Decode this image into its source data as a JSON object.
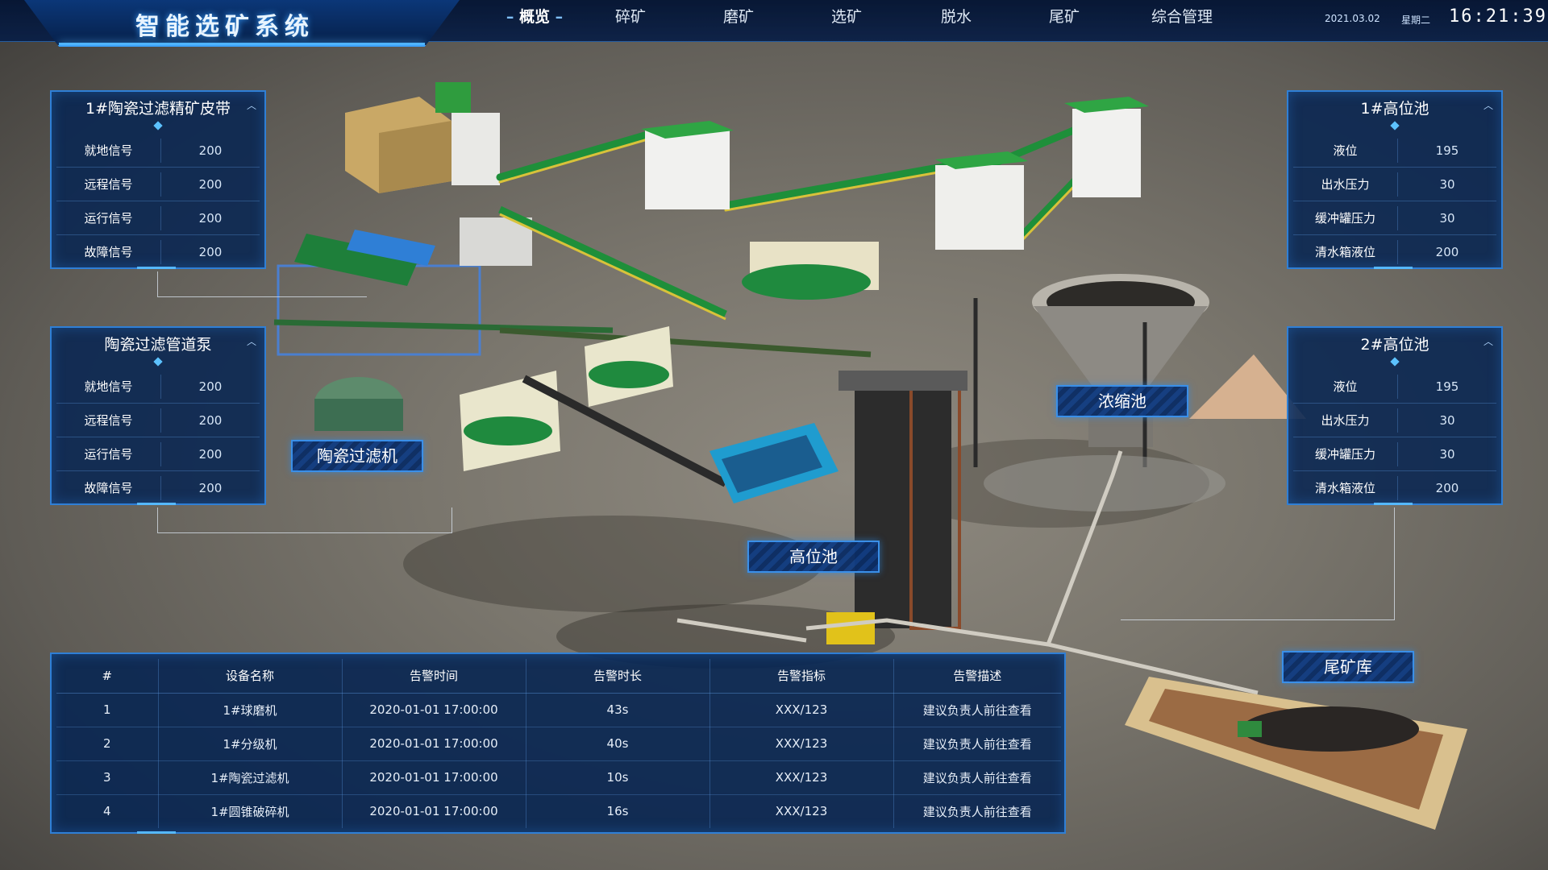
{
  "header": {
    "title": "智能选矿系统",
    "nav": [
      {
        "label": "概览",
        "active": true
      },
      {
        "label": "碎矿",
        "active": false
      },
      {
        "label": "磨矿",
        "active": false
      },
      {
        "label": "选矿",
        "active": false
      },
      {
        "label": "脱水",
        "active": false
      },
      {
        "label": "尾矿",
        "active": false
      },
      {
        "label": "综合管理",
        "active": false
      }
    ],
    "date": "2021.03.02",
    "weekday": "星期二",
    "time": "16:21:39"
  },
  "panels": {
    "belt": {
      "title": "1#陶瓷过滤精矿皮带",
      "rows": [
        {
          "key": "就地信号",
          "value": "200"
        },
        {
          "key": "远程信号",
          "value": "200"
        },
        {
          "key": "运行信号",
          "value": "200"
        },
        {
          "key": "故障信号",
          "value": "200"
        }
      ]
    },
    "pump": {
      "title": "陶瓷过滤管道泵",
      "rows": [
        {
          "key": "就地信号",
          "value": "200"
        },
        {
          "key": "远程信号",
          "value": "200"
        },
        {
          "key": "运行信号",
          "value": "200"
        },
        {
          "key": "故障信号",
          "value": "200"
        }
      ]
    },
    "pool1": {
      "title": "1#高位池",
      "rows": [
        {
          "key": "液位",
          "value": "195"
        },
        {
          "key": "出水压力",
          "value": "30"
        },
        {
          "key": "缓冲罐压力",
          "value": "30"
        },
        {
          "key": "清水箱液位",
          "value": "200"
        }
      ]
    },
    "pool2": {
      "title": "2#高位池",
      "rows": [
        {
          "key": "液位",
          "value": "195"
        },
        {
          "key": "出水压力",
          "value": "30"
        },
        {
          "key": "缓冲罐压力",
          "value": "30"
        },
        {
          "key": "清水箱液位",
          "value": "200"
        }
      ]
    }
  },
  "labels": {
    "ceramic_filter": "陶瓷过滤机",
    "thickener": "浓缩池",
    "high_pool": "高位池",
    "tailings": "尾矿库"
  },
  "alarms": {
    "columns": [
      "#",
      "设备名称",
      "告警时间",
      "告警时长",
      "告警指标",
      "告警描述"
    ],
    "rows": [
      [
        "1",
        "1#球磨机",
        "2020-01-01  17:00:00",
        "43s",
        "XXX/123",
        "建议负责人前往查看"
      ],
      [
        "2",
        "1#分级机",
        "2020-01-01  17:00:00",
        "40s",
        "XXX/123",
        "建议负责人前往查看"
      ],
      [
        "3",
        "1#陶瓷过滤机",
        "2020-01-01  17:00:00",
        "10s",
        "XXX/123",
        "建议负责人前往查看"
      ],
      [
        "4",
        "1#圆锥破碎机",
        "2020-01-01  17:00:00",
        "16s",
        "XXX/123",
        "建议负责人前往查看"
      ]
    ]
  },
  "colors": {
    "panel_bg": "#08264f",
    "panel_border": "#2f7fd6",
    "accent": "#55b8ff",
    "conveyor_green": "#1e8f3a",
    "conveyor_yellow": "#d8c23a"
  }
}
